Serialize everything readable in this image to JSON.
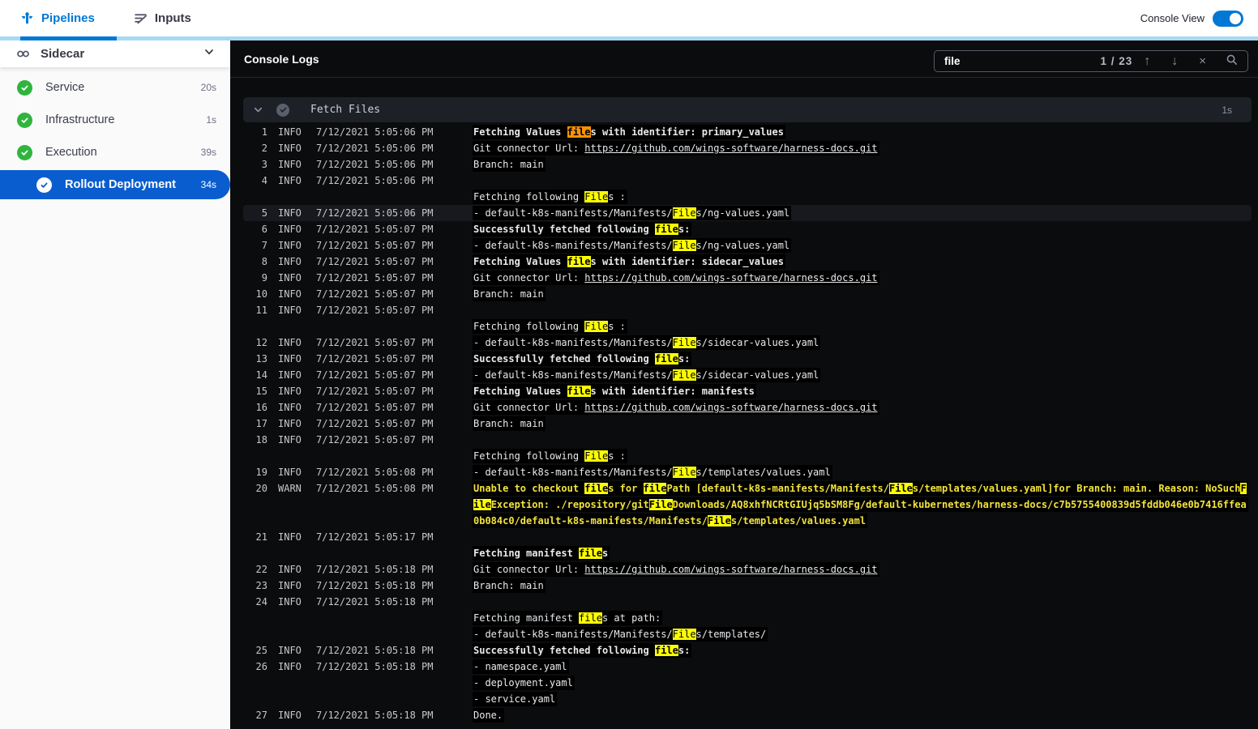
{
  "topbar": {
    "tabs": [
      {
        "label": "Pipelines",
        "icon": "pipeline-icon",
        "active": true
      },
      {
        "label": "Inputs",
        "icon": "inputs-icon",
        "active": false
      }
    ],
    "console_view_label": "Console View",
    "console_view_on": true
  },
  "sidebar": {
    "title": "Sidecar",
    "items": [
      {
        "label": "Service",
        "duration": "20s",
        "status": "success",
        "selected": false
      },
      {
        "label": "Infrastructure",
        "duration": "1s",
        "status": "success",
        "selected": false
      },
      {
        "label": "Execution",
        "duration": "39s",
        "status": "success",
        "selected": false
      },
      {
        "label": "Rollout Deployment",
        "duration": "34s",
        "status": "success",
        "selected": true
      }
    ]
  },
  "console": {
    "title": "Console Logs",
    "search": {
      "value": "file",
      "match_position": "1 / 23"
    },
    "section": {
      "title": "Fetch Files",
      "duration": "1s"
    }
  },
  "colors": {
    "accent_blue": "#0278d5",
    "selected_blue": "#0a5dce",
    "success_green": "#2fb53d",
    "match_yellow": "#fdff00",
    "match_current_orange": "#ff9201",
    "warn_text": "#f2e33c",
    "console_bg": "#0b0c0e"
  },
  "log_rows": [
    {
      "n": "1",
      "lvl": "INFO",
      "ts": "7/12/2021 5:05:06 PM",
      "style": "bold",
      "hl": false,
      "seg": [
        [
          "t",
          "Fetching Values "
        ],
        [
          "o",
          "file"
        ],
        [
          "t",
          "s with identifier: primary_values"
        ]
      ]
    },
    {
      "n": "2",
      "lvl": "INFO",
      "ts": "7/12/2021 5:05:06 PM",
      "style": "plain",
      "hl": false,
      "seg": [
        [
          "t",
          "Git connector Url: "
        ],
        [
          "l",
          "https://github.com/wings-software/harness-docs.git"
        ]
      ]
    },
    {
      "n": "3",
      "lvl": "INFO",
      "ts": "7/12/2021 5:05:06 PM",
      "style": "plain",
      "hl": false,
      "seg": [
        [
          "t",
          "Branch: main"
        ]
      ]
    },
    {
      "n": "4",
      "lvl": "INFO",
      "ts": "7/12/2021 5:05:06 PM",
      "style": "plain",
      "hl": false,
      "seg": []
    },
    {
      "n": "",
      "lvl": "",
      "ts": "",
      "style": "plain",
      "hl": false,
      "seg": [
        [
          "t",
          "Fetching following "
        ],
        [
          "y",
          "File"
        ],
        [
          "t",
          "s :"
        ]
      ]
    },
    {
      "n": "5",
      "lvl": "INFO",
      "ts": "7/12/2021 5:05:06 PM",
      "style": "plain",
      "hl": true,
      "seg": [
        [
          "t",
          "- default-k8s-manifests/Manifests/"
        ],
        [
          "y",
          "File"
        ],
        [
          "t",
          "s/ng-values.yaml"
        ]
      ]
    },
    {
      "n": "6",
      "lvl": "INFO",
      "ts": "7/12/2021 5:05:07 PM",
      "style": "bold",
      "hl": false,
      "seg": [
        [
          "t",
          "Successfully fetched following "
        ],
        [
          "y",
          "file"
        ],
        [
          "t",
          "s:"
        ]
      ]
    },
    {
      "n": "7",
      "lvl": "INFO",
      "ts": "7/12/2021 5:05:07 PM",
      "style": "plain",
      "hl": false,
      "seg": [
        [
          "t",
          "- default-k8s-manifests/Manifests/"
        ],
        [
          "y",
          "File"
        ],
        [
          "t",
          "s/ng-values.yaml"
        ]
      ]
    },
    {
      "n": "8",
      "lvl": "INFO",
      "ts": "7/12/2021 5:05:07 PM",
      "style": "bold",
      "hl": false,
      "seg": [
        [
          "t",
          "Fetching Values "
        ],
        [
          "y",
          "file"
        ],
        [
          "t",
          "s with identifier: sidecar_values"
        ]
      ]
    },
    {
      "n": "9",
      "lvl": "INFO",
      "ts": "7/12/2021 5:05:07 PM",
      "style": "plain",
      "hl": false,
      "seg": [
        [
          "t",
          "Git connector Url: "
        ],
        [
          "l",
          "https://github.com/wings-software/harness-docs.git"
        ]
      ]
    },
    {
      "n": "10",
      "lvl": "INFO",
      "ts": "7/12/2021 5:05:07 PM",
      "style": "plain",
      "hl": false,
      "seg": [
        [
          "t",
          "Branch: main"
        ]
      ]
    },
    {
      "n": "11",
      "lvl": "INFO",
      "ts": "7/12/2021 5:05:07 PM",
      "style": "plain",
      "hl": false,
      "seg": []
    },
    {
      "n": "",
      "lvl": "",
      "ts": "",
      "style": "plain",
      "hl": false,
      "seg": [
        [
          "t",
          "Fetching following "
        ],
        [
          "y",
          "File"
        ],
        [
          "t",
          "s :"
        ]
      ]
    },
    {
      "n": "12",
      "lvl": "INFO",
      "ts": "7/12/2021 5:05:07 PM",
      "style": "plain",
      "hl": false,
      "seg": [
        [
          "t",
          "- default-k8s-manifests/Manifests/"
        ],
        [
          "y",
          "File"
        ],
        [
          "t",
          "s/sidecar-values.yaml"
        ]
      ]
    },
    {
      "n": "13",
      "lvl": "INFO",
      "ts": "7/12/2021 5:05:07 PM",
      "style": "bold",
      "hl": false,
      "seg": [
        [
          "t",
          "Successfully fetched following "
        ],
        [
          "y",
          "file"
        ],
        [
          "t",
          "s:"
        ]
      ]
    },
    {
      "n": "14",
      "lvl": "INFO",
      "ts": "7/12/2021 5:05:07 PM",
      "style": "plain",
      "hl": false,
      "seg": [
        [
          "t",
          "- default-k8s-manifests/Manifests/"
        ],
        [
          "y",
          "File"
        ],
        [
          "t",
          "s/sidecar-values.yaml"
        ]
      ]
    },
    {
      "n": "15",
      "lvl": "INFO",
      "ts": "7/12/2021 5:05:07 PM",
      "style": "bold",
      "hl": false,
      "seg": [
        [
          "t",
          "Fetching Values "
        ],
        [
          "y",
          "file"
        ],
        [
          "t",
          "s with identifier: manifests"
        ]
      ]
    },
    {
      "n": "16",
      "lvl": "INFO",
      "ts": "7/12/2021 5:05:07 PM",
      "style": "plain",
      "hl": false,
      "seg": [
        [
          "t",
          "Git connector Url: "
        ],
        [
          "l",
          "https://github.com/wings-software/harness-docs.git"
        ]
      ]
    },
    {
      "n": "17",
      "lvl": "INFO",
      "ts": "7/12/2021 5:05:07 PM",
      "style": "plain",
      "hl": false,
      "seg": [
        [
          "t",
          "Branch: main"
        ]
      ]
    },
    {
      "n": "18",
      "lvl": "INFO",
      "ts": "7/12/2021 5:05:07 PM",
      "style": "plain",
      "hl": false,
      "seg": []
    },
    {
      "n": "",
      "lvl": "",
      "ts": "",
      "style": "plain",
      "hl": false,
      "seg": [
        [
          "t",
          "Fetching following "
        ],
        [
          "y",
          "File"
        ],
        [
          "t",
          "s :"
        ]
      ]
    },
    {
      "n": "19",
      "lvl": "INFO",
      "ts": "7/12/2021 5:05:08 PM",
      "style": "plain",
      "hl": false,
      "seg": [
        [
          "t",
          "- default-k8s-manifests/Manifests/"
        ],
        [
          "y",
          "File"
        ],
        [
          "t",
          "s/templates/values.yaml"
        ]
      ]
    },
    {
      "n": "20",
      "lvl": "WARN",
      "ts": "7/12/2021 5:05:08 PM",
      "style": "warn",
      "hl": false,
      "seg": [
        [
          "t",
          "Unable to checkout "
        ],
        [
          "y",
          "file"
        ],
        [
          "t",
          "s for "
        ],
        [
          "y",
          "file"
        ],
        [
          "t",
          "Path [default-k8s-manifests/Manifests/"
        ],
        [
          "y",
          "File"
        ],
        [
          "t",
          "s/templates/values.yaml]for Branch: main. Reason: NoSuch"
        ],
        [
          "y",
          "F"
        ]
      ]
    },
    {
      "n": "",
      "lvl": "",
      "ts": "",
      "style": "warn",
      "hl": false,
      "seg": [
        [
          "y",
          "ile"
        ],
        [
          "t",
          "Exception: ./repository/git"
        ],
        [
          "y",
          "File"
        ],
        [
          "t",
          "Downloads/AQ8xhfNCRtGIUjq5bSM8Fg/default-kubernetes/harness-docs/c7b5755400839d5fddb046e0b7416ffea"
        ]
      ]
    },
    {
      "n": "",
      "lvl": "",
      "ts": "",
      "style": "warn",
      "hl": false,
      "seg": [
        [
          "t",
          "0b084c0/default-k8s-manifests/Manifests/"
        ],
        [
          "y",
          "File"
        ],
        [
          "t",
          "s/templates/values.yaml"
        ]
      ]
    },
    {
      "n": "21",
      "lvl": "INFO",
      "ts": "7/12/2021 5:05:17 PM",
      "style": "plain",
      "hl": false,
      "seg": []
    },
    {
      "n": "",
      "lvl": "",
      "ts": "",
      "style": "bold",
      "hl": false,
      "seg": [
        [
          "t",
          "Fetching manifest "
        ],
        [
          "y",
          "file"
        ],
        [
          "t",
          "s"
        ]
      ]
    },
    {
      "n": "22",
      "lvl": "INFO",
      "ts": "7/12/2021 5:05:18 PM",
      "style": "plain",
      "hl": false,
      "seg": [
        [
          "t",
          "Git connector Url: "
        ],
        [
          "l",
          "https://github.com/wings-software/harness-docs.git"
        ]
      ]
    },
    {
      "n": "23",
      "lvl": "INFO",
      "ts": "7/12/2021 5:05:18 PM",
      "style": "plain",
      "hl": false,
      "seg": [
        [
          "t",
          "Branch: main"
        ]
      ]
    },
    {
      "n": "24",
      "lvl": "INFO",
      "ts": "7/12/2021 5:05:18 PM",
      "style": "plain",
      "hl": false,
      "seg": []
    },
    {
      "n": "",
      "lvl": "",
      "ts": "",
      "style": "plain",
      "hl": false,
      "seg": [
        [
          "t",
          "Fetching manifest "
        ],
        [
          "y",
          "file"
        ],
        [
          "t",
          "s at path:"
        ]
      ]
    },
    {
      "n": "",
      "lvl": "",
      "ts": "",
      "style": "plain",
      "hl": false,
      "seg": [
        [
          "t",
          "- default-k8s-manifests/Manifests/"
        ],
        [
          "y",
          "File"
        ],
        [
          "t",
          "s/templates/"
        ]
      ]
    },
    {
      "n": "25",
      "lvl": "INFO",
      "ts": "7/12/2021 5:05:18 PM",
      "style": "bold",
      "hl": false,
      "seg": [
        [
          "t",
          "Successfully fetched following "
        ],
        [
          "y",
          "file"
        ],
        [
          "t",
          "s:"
        ]
      ]
    },
    {
      "n": "26",
      "lvl": "INFO",
      "ts": "7/12/2021 5:05:18 PM",
      "style": "plain",
      "hl": false,
      "seg": [
        [
          "t",
          "- namespace.yaml"
        ]
      ]
    },
    {
      "n": "",
      "lvl": "",
      "ts": "",
      "style": "plain",
      "hl": false,
      "seg": [
        [
          "t",
          "- deployment.yaml"
        ]
      ]
    },
    {
      "n": "",
      "lvl": "",
      "ts": "",
      "style": "plain",
      "hl": false,
      "seg": [
        [
          "t",
          "- service.yaml"
        ]
      ]
    },
    {
      "n": "27",
      "lvl": "INFO",
      "ts": "7/12/2021 5:05:18 PM",
      "style": "plain",
      "hl": false,
      "seg": [
        [
          "t",
          "Done."
        ]
      ]
    }
  ]
}
